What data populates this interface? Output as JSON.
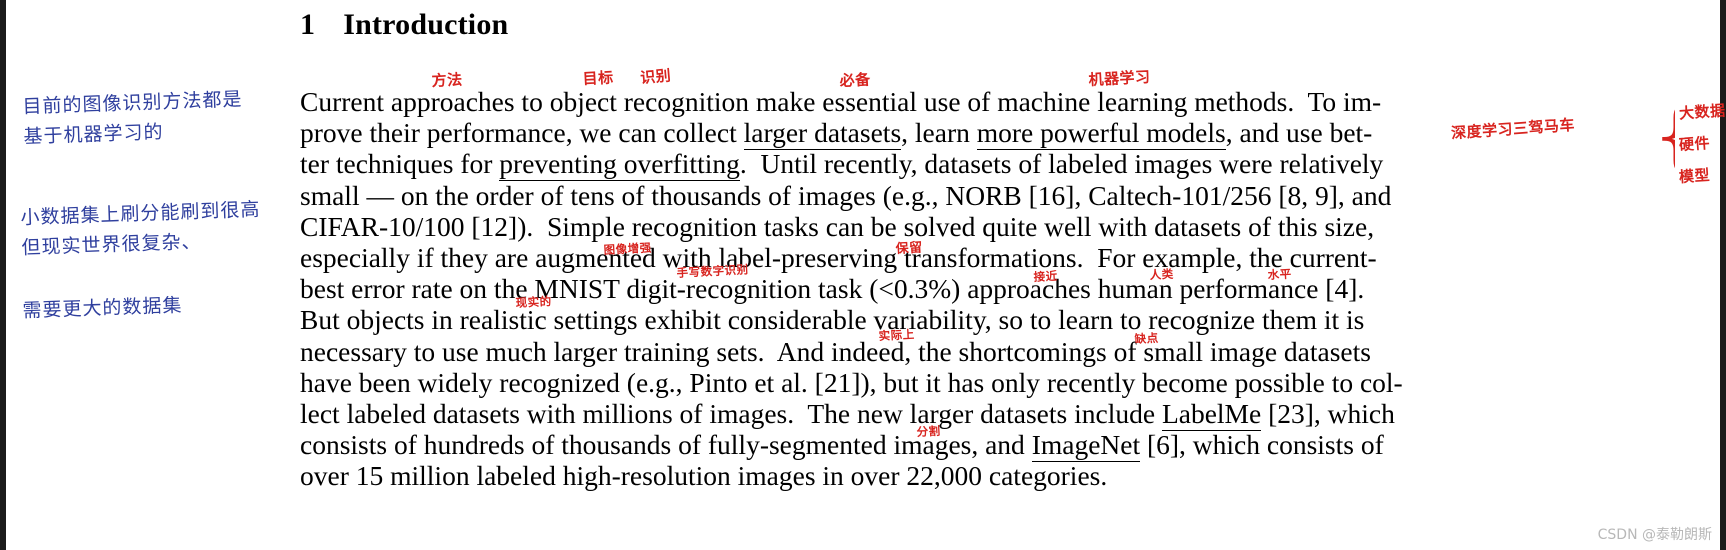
{
  "document": {
    "section_number": "1",
    "section_title": "Introduction",
    "lines": [
      "Current approaches to object recognition make essential use of machine learning methods.  To im-",
      "prove their performance, we can collect larger datasets, learn more powerful models, and use bet-",
      "ter techniques for preventing overfitting.  Until recently, datasets of labeled images were relatively",
      "small — on the order of tens of thousands of images (e.g., NORB [16], Caltech-101/256 [8, 9], and",
      "CIFAR-10/100 [12]).  Simple recognition tasks can be solved quite well with datasets of this size,",
      "especially if they are augmented with label-preserving transformations.  For example, the current-",
      "best error rate on the MNIST digit-recognition task (<0.3%) approaches human performance [4].",
      "But objects in realistic settings exhibit considerable variability, so to learn to recognize them it is",
      "necessary to use much larger training sets.  And indeed, the shortcomings of small image datasets",
      "have been widely recognized (e.g., Pinto et al. [21]), but it has only recently become possible to col-",
      "lect labeled datasets with millions of images.  The new larger datasets include LabelMe [23], which",
      "consists of hundreds of thousands of fully-segmented images, and ImageNet [6], which consists of",
      "over 15 million labeled high-resolution images in over 22,000 categories."
    ],
    "underlined_phrases": [
      "larger datasets",
      "more powerful models",
      "preventing overfitting",
      "LabelMe",
      "ImageNet"
    ]
  },
  "annotations": {
    "blue_margin_notes": [
      {
        "id": "note-1",
        "text": "目前的图像识别方法都是\n基于机器学习的"
      },
      {
        "id": "note-2",
        "text": "小数据集上刷分能刷到很高\n但现实世界很复杂、"
      },
      {
        "id": "note-3",
        "text": "需要更大的数据集"
      }
    ],
    "red_inline_glosses": [
      {
        "id": "gloss-fangfa",
        "text": "方法",
        "over": "approaches"
      },
      {
        "id": "gloss-mubiao",
        "text": "目标",
        "over": "object"
      },
      {
        "id": "gloss-shibie",
        "text": "识别",
        "over": "recognition"
      },
      {
        "id": "gloss-bibei",
        "text": "必备",
        "over": "essential"
      },
      {
        "id": "gloss-jqxx",
        "text": "机器学习",
        "over": "machine learning"
      },
      {
        "id": "gloss-txzq",
        "text": "图像增强",
        "over": "augmented"
      },
      {
        "id": "gloss-baoliu",
        "text": "保留",
        "over": "preserving"
      },
      {
        "id": "gloss-sxszsb",
        "text": "手写数字识别",
        "over": "MNIST digit-recognition"
      },
      {
        "id": "gloss-jiejin",
        "text": "接近",
        "over": "approaches"
      },
      {
        "id": "gloss-renlei",
        "text": "人类",
        "over": "human"
      },
      {
        "id": "gloss-shuiping",
        "text": "水平",
        "over": "performance"
      },
      {
        "id": "gloss-xianshi",
        "text": "现实的",
        "over": "realistic"
      },
      {
        "id": "gloss-shijishang",
        "text": "实际上",
        "over": "indeed"
      },
      {
        "id": "gloss-quedian",
        "text": "缺点",
        "over": "shortcomings"
      },
      {
        "id": "gloss-fenge",
        "text": "分割",
        "over": "fully-segmented"
      }
    ],
    "red_margin_note": {
      "label": "深度学习三驾马车",
      "items": [
        "大数据",
        "硬件",
        "模型"
      ]
    }
  },
  "watermark": {
    "text": "CSDN @泰勒朗斯"
  },
  "colors": {
    "red_pen": "#d8241f",
    "blue_pen": "#2f3f9e",
    "watermark": "#b8b8b8",
    "paper": "#ffffff"
  }
}
